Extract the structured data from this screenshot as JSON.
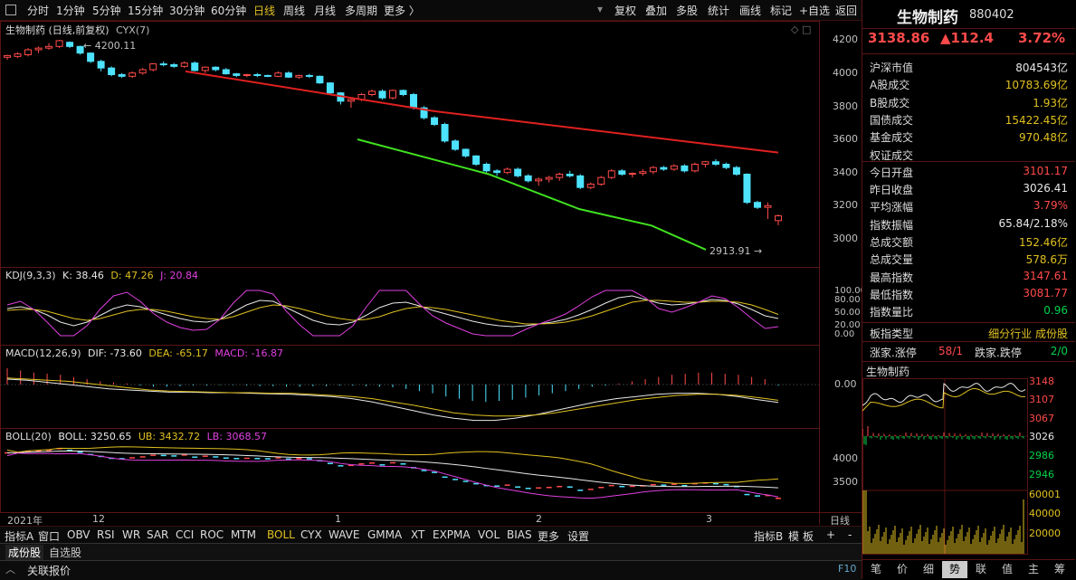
{
  "toolbar": {
    "periods": [
      "分时",
      "1分钟",
      "5分钟",
      "15分钟",
      "30分钟",
      "60分钟",
      "日线",
      "周线",
      "月线",
      "多周期",
      "更多 〉"
    ],
    "active_period": "日线",
    "actions": [
      "复权",
      "叠加",
      "多股",
      "统计",
      "画线",
      "标记",
      "+自选",
      "返回"
    ]
  },
  "main_chart": {
    "title": "生物制药 (日线,前复权)",
    "indicator": "CYX(7)",
    "high_label": "4200.11",
    "low_label": "2913.91",
    "y_ticks": [
      "4200",
      "4000",
      "3800",
      "3600",
      "3400",
      "3200",
      "3000"
    ],
    "candles": [
      [
        4095,
        4110,
        4080,
        4105
      ],
      [
        4100,
        4125,
        4090,
        4115
      ],
      [
        4110,
        4150,
        4100,
        4140
      ],
      [
        4140,
        4160,
        4120,
        4150
      ],
      [
        4150,
        4180,
        4140,
        4160
      ],
      [
        4160,
        4200,
        4150,
        4195
      ],
      [
        4185,
        4190,
        4150,
        4160
      ],
      [
        4160,
        4165,
        4110,
        4120
      ],
      [
        4120,
        4125,
        4060,
        4070
      ],
      [
        4070,
        4080,
        4010,
        4030
      ],
      [
        4030,
        4040,
        3980,
        3990
      ],
      [
        3990,
        4000,
        3970,
        3980
      ],
      [
        3980,
        4010,
        3970,
        4000
      ],
      [
        4000,
        4030,
        3990,
        4020
      ],
      [
        4020,
        4060,
        4010,
        4055
      ],
      [
        4055,
        4070,
        4040,
        4050
      ],
      [
        4050,
        4060,
        4030,
        4040
      ],
      [
        4040,
        4070,
        4030,
        4060
      ],
      [
        4060,
        4070,
        4010,
        4015
      ],
      [
        4015,
        4040,
        4000,
        4035
      ],
      [
        4035,
        4040,
        4010,
        4020
      ],
      [
        4020,
        4030,
        3990,
        3995
      ],
      [
        3995,
        4000,
        3975,
        3985
      ],
      [
        3985,
        3995,
        3975,
        3990
      ],
      [
        3990,
        4000,
        3975,
        3985
      ],
      [
        3985,
        3990,
        3975,
        3980
      ],
      [
        3980,
        4010,
        3975,
        4000
      ],
      [
        4000,
        4010,
        3970,
        3975
      ],
      [
        3975,
        3990,
        3965,
        3985
      ],
      [
        3985,
        3995,
        3970,
        3980
      ],
      [
        3980,
        3985,
        3935,
        3940
      ],
      [
        3940,
        3945,
        3870,
        3880
      ],
      [
        3880,
        3885,
        3810,
        3830
      ],
      [
        3830,
        3850,
        3790,
        3840
      ],
      [
        3840,
        3880,
        3830,
        3870
      ],
      [
        3870,
        3900,
        3860,
        3890
      ],
      [
        3890,
        3900,
        3840,
        3850
      ],
      [
        3850,
        3900,
        3840,
        3895
      ],
      [
        3895,
        3900,
        3860,
        3870
      ],
      [
        3870,
        3880,
        3780,
        3790
      ],
      [
        3790,
        3800,
        3720,
        3730
      ],
      [
        3730,
        3740,
        3680,
        3690
      ],
      [
        3690,
        3700,
        3580,
        3590
      ],
      [
        3590,
        3600,
        3530,
        3540
      ],
      [
        3540,
        3545,
        3490,
        3500
      ],
      [
        3500,
        3505,
        3440,
        3450
      ],
      [
        3450,
        3460,
        3400,
        3410
      ],
      [
        3410,
        3420,
        3380,
        3400
      ],
      [
        3400,
        3430,
        3390,
        3420
      ],
      [
        3420,
        3430,
        3370,
        3380
      ],
      [
        3380,
        3390,
        3340,
        3350
      ],
      [
        3350,
        3370,
        3320,
        3360
      ],
      [
        3360,
        3380,
        3340,
        3370
      ],
      [
        3370,
        3400,
        3350,
        3390
      ],
      [
        3390,
        3410,
        3370,
        3380
      ],
      [
        3380,
        3390,
        3300,
        3310
      ],
      [
        3310,
        3340,
        3300,
        3330
      ],
      [
        3330,
        3380,
        3320,
        3370
      ],
      [
        3370,
        3420,
        3360,
        3410
      ],
      [
        3410,
        3420,
        3380,
        3390
      ],
      [
        3390,
        3400,
        3370,
        3395
      ],
      [
        3395,
        3420,
        3380,
        3405
      ],
      [
        3405,
        3440,
        3390,
        3430
      ],
      [
        3430,
        3440,
        3410,
        3420
      ],
      [
        3420,
        3450,
        3410,
        3440
      ],
      [
        3440,
        3450,
        3400,
        3410
      ],
      [
        3410,
        3460,
        3400,
        3450
      ],
      [
        3450,
        3470,
        3430,
        3465
      ],
      [
        3465,
        3480,
        3440,
        3450
      ],
      [
        3450,
        3460,
        3420,
        3430
      ],
      [
        3430,
        3440,
        3380,
        3390
      ],
      [
        3390,
        3395,
        3210,
        3220
      ],
      [
        3220,
        3230,
        3180,
        3190
      ],
      [
        3190,
        3220,
        3120,
        3200
      ],
      [
        3110,
        3147.61,
        3081.77,
        3138.86
      ]
    ],
    "cyx_upper": [
      [
        22,
        4010
      ],
      [
        64,
        3880
      ],
      [
        107,
        3770
      ],
      [
        150,
        3640
      ],
      [
        193,
        3520
      ]
    ],
    "cyx_lower": [
      [
        45,
        3600
      ],
      [
        95,
        3400
      ],
      [
        140,
        3180
      ],
      [
        170,
        2935
      ]
    ]
  },
  "kdj": {
    "label": "KDJ(9,3,3)",
    "K": "K: 38.46",
    "D": "D: 47.26",
    "J": "J: 20.84",
    "y_ticks": [
      "100.00",
      "80.00",
      "50.00",
      "20.00",
      "0.00"
    ],
    "k_vals": [
      60,
      64,
      58,
      46,
      30,
      22,
      30,
      45,
      60,
      68,
      64,
      55,
      46,
      38,
      32,
      30,
      36,
      52,
      68,
      78,
      76,
      62,
      48,
      34,
      26,
      24,
      30,
      45,
      62,
      72,
      74,
      66,
      56,
      48,
      40,
      32,
      26,
      22,
      20,
      22,
      26,
      30,
      36,
      46,
      58,
      72,
      84,
      88,
      80,
      72,
      68,
      70,
      74,
      80,
      78,
      70,
      58,
      44,
      38
    ],
    "d_vals": [
      56,
      58,
      58,
      54,
      46,
      38,
      34,
      38,
      46,
      54,
      58,
      58,
      54,
      48,
      42,
      38,
      36,
      42,
      52,
      62,
      68,
      66,
      60,
      52,
      44,
      38,
      34,
      36,
      42,
      52,
      60,
      64,
      62,
      58,
      52,
      46,
      40,
      34,
      30,
      26,
      26,
      27,
      30,
      36,
      44,
      54,
      64,
      74,
      78,
      78,
      76,
      74,
      74,
      76,
      76,
      74,
      68,
      58,
      47
    ]
  },
  "macd": {
    "label": "MACD(12,26,9)",
    "DIF": "DIF: -73.60",
    "DEA": "DEA: -65.17",
    "MACD": "MACD: -16.87",
    "zero_label": "0.00",
    "bars": [
      30,
      26,
      22,
      20,
      18,
      14,
      10,
      6,
      4,
      2,
      -2,
      -4,
      -4,
      -3,
      -2,
      -2,
      -1,
      -1,
      -2,
      -3,
      -3,
      -4,
      -4,
      -3,
      -3,
      -2,
      -2,
      -3,
      -4,
      -5,
      -8,
      -12,
      -16,
      -22,
      -26,
      -30,
      -32,
      -30,
      -28,
      -24,
      -20,
      -16,
      -12,
      -8,
      -4,
      -2,
      2,
      6,
      10,
      14,
      18,
      20,
      22,
      22,
      20,
      18,
      14,
      10,
      -2
    ],
    "dif": [
      10,
      8,
      4,
      0,
      -4,
      -8,
      -10,
      -12,
      -14,
      -14,
      -15,
      -15,
      -16,
      -17,
      -18,
      -20,
      -22,
      -26,
      -32,
      -40,
      -48,
      -56,
      -62,
      -66,
      -66,
      -62,
      -56,
      -48,
      -40,
      -32,
      -26,
      -22,
      -18,
      -16,
      -16,
      -18,
      -22,
      -28,
      -33
    ],
    "dea": [
      12,
      10,
      8,
      6,
      2,
      -2,
      -6,
      -10,
      -12,
      -13,
      -14,
      -15,
      -15,
      -16,
      -16,
      -18,
      -20,
      -22,
      -26,
      -32,
      -38,
      -45,
      -52,
      -56,
      -58,
      -58,
      -56,
      -52,
      -46,
      -40,
      -34,
      -28,
      -24,
      -20,
      -18,
      -18,
      -20,
      -24,
      -29
    ]
  },
  "boll": {
    "label": "BOLL(20)",
    "BOLL": "BOLL: 3250.65",
    "UB": "UB: 3432.72",
    "LB": "LB: 3068.57",
    "y_ticks": [
      "4000",
      "3500"
    ]
  },
  "x_axis": {
    "labels": [
      "2021年",
      "12",
      "1",
      "2",
      "3"
    ],
    "right_label": "日线"
  },
  "indicator_tabs": [
    "指标A",
    "窗口",
    "OBV",
    "RSI",
    "WR",
    "SAR",
    "CCI",
    "ROC",
    "MTM",
    "BOLL",
    "CYX",
    "WAVE",
    "GMMA",
    "XT",
    "EXPMA",
    "VOL",
    "BIAS",
    "更多",
    "设置"
  ],
  "active_indicator": "BOLL",
  "indicator_right": [
    "指标B",
    "模",
    "板",
    "+",
    "-"
  ],
  "bottom_tabs": [
    "成份股",
    "自选股"
  ],
  "status_bar": {
    "label": "关联报价",
    "key": "F10"
  },
  "quote": {
    "name": "生物制药",
    "code": "880402",
    "price": "3138.86",
    "change": "▲112.4",
    "pct": "3.72%",
    "rows": [
      {
        "k": "沪深市值",
        "v": "804543亿",
        "c": "#e8e8e8"
      },
      {
        "k": "A股成交",
        "v": "10783.69亿",
        "c": "#e0c020"
      },
      {
        "k": "B股成交",
        "v": "1.93亿",
        "c": "#e0c020"
      },
      {
        "k": "国债成交",
        "v": "15422.45亿",
        "c": "#e0c020"
      },
      {
        "k": "基金成交",
        "v": "970.48亿",
        "c": "#e0c020"
      },
      {
        "k": "权证成交",
        "v": "",
        "c": "#e0c020"
      },
      {
        "k": "今日开盘",
        "v": "3101.17",
        "c": "#ff4a4a"
      },
      {
        "k": "昨日收盘",
        "v": "3026.41",
        "c": "#e8e8e8"
      },
      {
        "k": "平均涨幅",
        "v": "3.79%",
        "c": "#ff4a4a"
      },
      {
        "k": "指数振幅",
        "v": "65.84/2.18%",
        "c": "#e8e8e8"
      },
      {
        "k": "总成交额",
        "v": "152.46亿",
        "c": "#e0c020"
      },
      {
        "k": "总成交量",
        "v": "578.6万",
        "c": "#e0c020"
      },
      {
        "k": "最高指数",
        "v": "3147.61",
        "c": "#ff4a4a"
      },
      {
        "k": "最低指数",
        "v": "3081.77",
        "c": "#ff4a4a"
      },
      {
        "k": "指数量比",
        "v": "0.96",
        "c": "#00d24a"
      }
    ],
    "sector_type_label": "板指类型",
    "sector_type_value": "细分行业 成份股",
    "up_label": "涨家.涨停",
    "up_value": "58/1",
    "down_label": "跌家.跌停",
    "down_value": "2/0"
  },
  "mini_chart": {
    "title": "生物制药",
    "y_ticks_red": [
      "3148",
      "3107",
      "3067"
    ],
    "y_mid": "3026",
    "y_ticks_green": [
      "2986",
      "2946"
    ],
    "vol_ticks": [
      "60001",
      "40000",
      "20000"
    ]
  },
  "right_tabs": [
    "笔",
    "价",
    "细",
    "势",
    "联",
    "值",
    "主",
    "筹"
  ],
  "active_right_tab": "势",
  "colors": {
    "up": "#ff4a4a",
    "down": "#4de3ff",
    "ma_upper": "#e02020",
    "ma_lower": "#40e020",
    "border": "#5a1414"
  }
}
